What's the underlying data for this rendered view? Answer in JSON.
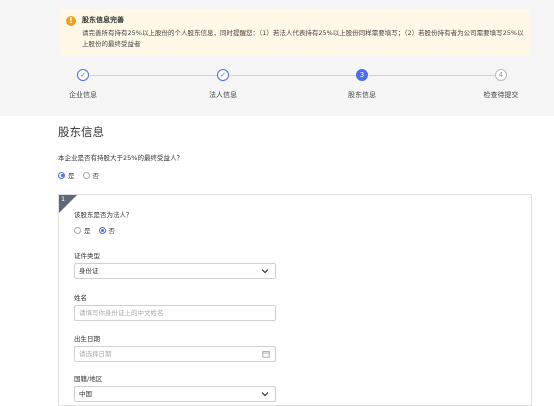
{
  "alert": {
    "title": "股东信息完善",
    "body": "请完善所有持有25%以上股份的个人股东信息，同时提醒您：（1）若法人代表持有25%以上股份同样需要填写；（2）若股份持有者为公司需要填写25%以上股份的最终受益者"
  },
  "steps": [
    {
      "label": "企业信息",
      "state": "done",
      "num": "✓"
    },
    {
      "label": "法人信息",
      "state": "done",
      "num": "✓"
    },
    {
      "label": "股东信息",
      "state": "active",
      "num": "3"
    },
    {
      "label": "检查待提交",
      "state": "todo",
      "num": "4"
    }
  ],
  "section": {
    "title": "股东信息",
    "question": "本企业是否有持股大于25%的最终受益人？",
    "yes": "是",
    "no": "否",
    "selected": "yes"
  },
  "card": {
    "index": "1",
    "question": "该股东是否为法人？",
    "yes": "是",
    "no": "否",
    "selected": "no",
    "id_type": {
      "label": "证件类型",
      "value": "身份证"
    },
    "name": {
      "label": "姓名",
      "placeholder": "请填写你身份证上的中文姓名"
    },
    "birth": {
      "label": "出生日期",
      "placeholder": "请选择日期"
    },
    "nationality": {
      "label": "国籍/地区",
      "value": "中国"
    }
  },
  "colors": {
    "accent": "#4a6cf7",
    "alert_bg": "#fff8e6",
    "alert_icon": "#f0a020"
  }
}
